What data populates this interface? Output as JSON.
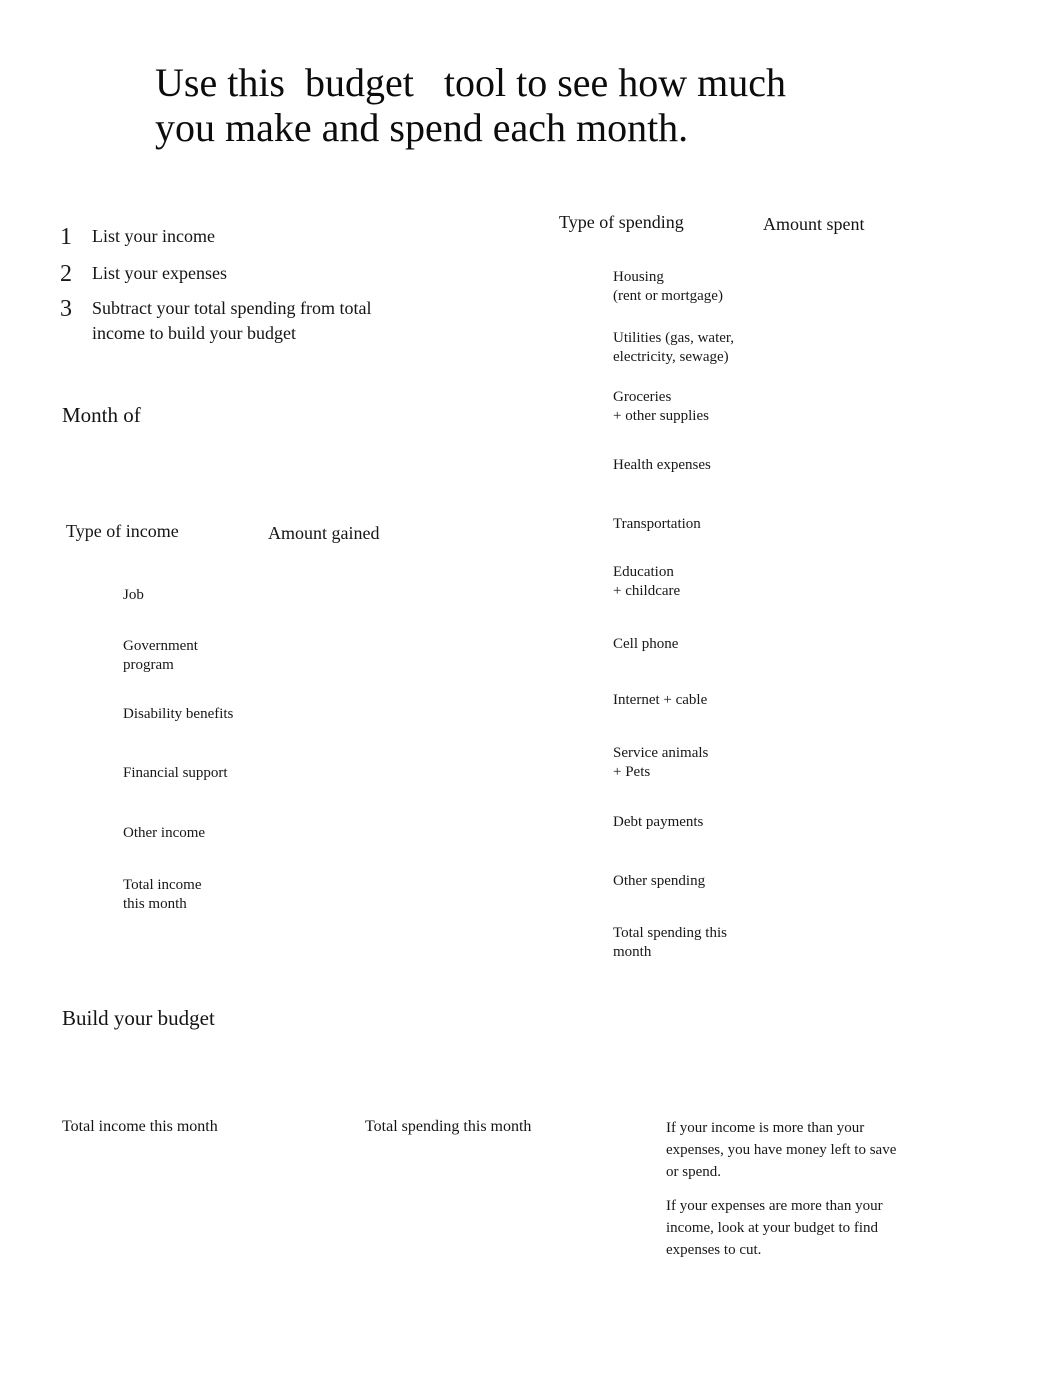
{
  "document": {
    "title": "Use this  budget   tool to see how much\nyou make and spend each month.",
    "background_color": "#ffffff",
    "text_color": "#141414"
  },
  "steps": [
    {
      "number": "1",
      "text": "List your income"
    },
    {
      "number": "2",
      "text": "List your expenses"
    },
    {
      "number": "3",
      "text": "Subtract your total spending from total\nincome to build your budget"
    }
  ],
  "month_section": {
    "heading": "Month of",
    "value": ""
  },
  "income_table": {
    "headers": {
      "type": "Type of income",
      "amount": "Amount gained"
    },
    "rows": [
      {
        "label": "Job",
        "amount": ""
      },
      {
        "label": "Government\nprogram",
        "amount": ""
      },
      {
        "label": "Disability benefits",
        "amount": ""
      },
      {
        "label": "Financial support",
        "amount": ""
      },
      {
        "label": "Other income",
        "amount": ""
      },
      {
        "label": "Total income\nthis month",
        "amount": ""
      }
    ]
  },
  "spending_table": {
    "headers": {
      "type": "Type of spending",
      "amount": "Amount spent"
    },
    "rows": [
      {
        "label": "Housing\n(rent or mortgage)",
        "amount": ""
      },
      {
        "label": "Utilities (gas, water,\nelectricity, sewage)",
        "amount": ""
      },
      {
        "label": "Groceries\n+ other supplies",
        "amount": ""
      },
      {
        "label": "Health expenses",
        "amount": ""
      },
      {
        "label": "Transportation",
        "amount": ""
      },
      {
        "label": "Education\n+ childcare",
        "amount": ""
      },
      {
        "label": "Cell phone",
        "amount": ""
      },
      {
        "label": "Internet + cable",
        "amount": ""
      },
      {
        "label": "Service animals\n+ Pets",
        "amount": ""
      },
      {
        "label": "Debt payments",
        "amount": ""
      },
      {
        "label": "Other spending",
        "amount": ""
      },
      {
        "label": "Total spending this\nmonth",
        "amount": ""
      }
    ]
  },
  "budget_section": {
    "heading": "Build your budget",
    "total_income_label": "Total income this month",
    "total_spending_label": "Total spending this month",
    "total_income_value": "",
    "total_spending_value": "",
    "notes": [
      "If your income is more than your expenses, you have money left to save or spend.",
      "If your expenses are more than your income, look at your budget to find expenses to cut."
    ]
  }
}
